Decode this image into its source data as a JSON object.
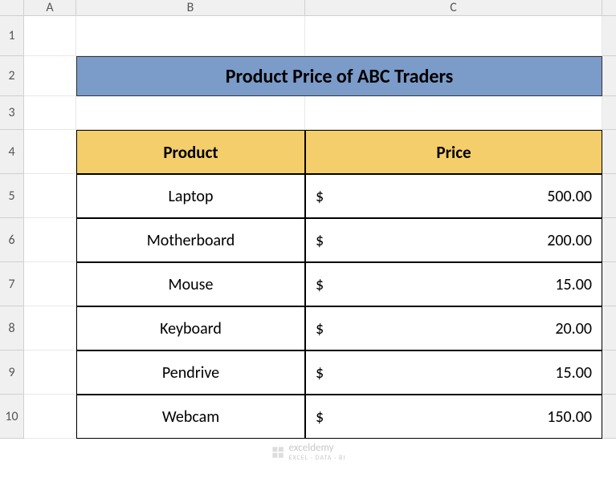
{
  "columns": [
    "A",
    "B",
    "C"
  ],
  "rows": [
    "1",
    "2",
    "3",
    "4",
    "5",
    "6",
    "7",
    "8",
    "9",
    "10"
  ],
  "title": "Product Price of ABC Traders",
  "headers": {
    "product": "Product",
    "price": "Price"
  },
  "currency": "$",
  "products": [
    {
      "name": "Laptop",
      "price": "500.00"
    },
    {
      "name": "Motherboard",
      "price": "200.00"
    },
    {
      "name": "Mouse",
      "price": "15.00"
    },
    {
      "name": "Keyboard",
      "price": "20.00"
    },
    {
      "name": "Pendrive",
      "price": "15.00"
    },
    {
      "name": "Webcam",
      "price": "150.00"
    }
  ],
  "watermark": {
    "main": "exceldemy",
    "sub": "EXCEL · DATA · BI"
  },
  "chart_data": {
    "type": "table",
    "title": "Product Price of ABC Traders",
    "columns": [
      "Product",
      "Price"
    ],
    "rows": [
      [
        "Laptop",
        500.0
      ],
      [
        "Motherboard",
        200.0
      ],
      [
        "Mouse",
        15.0
      ],
      [
        "Keyboard",
        20.0
      ],
      [
        "Pendrive",
        15.0
      ],
      [
        "Webcam",
        150.0
      ]
    ]
  }
}
